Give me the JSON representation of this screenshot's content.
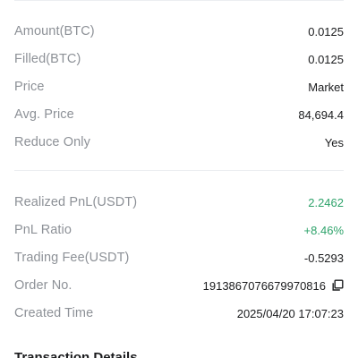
{
  "order": {
    "rows_top": [
      {
        "label": "Amount(BTC)",
        "value": "0.0125"
      },
      {
        "label": "Filled(BTC)",
        "value": "0.0125"
      },
      {
        "label": "Price",
        "value": "Market"
      },
      {
        "label": "Avg. Price",
        "value": "84,694.4"
      },
      {
        "label": "Reduce Only",
        "value": "Yes"
      }
    ],
    "rows_bottom": [
      {
        "label": "Realized PnL(USDT)",
        "value": "2.2462"
      },
      {
        "label": "PnL Ratio",
        "value": "+8.46%"
      },
      {
        "label": "Trading Fee(USDT)",
        "value": "-0.5293"
      },
      {
        "label": "Order No.",
        "value": "1913867076679970816"
      },
      {
        "label": "Created Time",
        "value": "2025/04/20 17:07:23"
      }
    ]
  },
  "icons": {
    "copy": "copy-icon"
  },
  "colors": {
    "profit_green": "#2fa36b",
    "label_gray": "#8d9197",
    "value_dark": "#1a1b1d"
  },
  "section": {
    "title": "Transaction Details"
  }
}
